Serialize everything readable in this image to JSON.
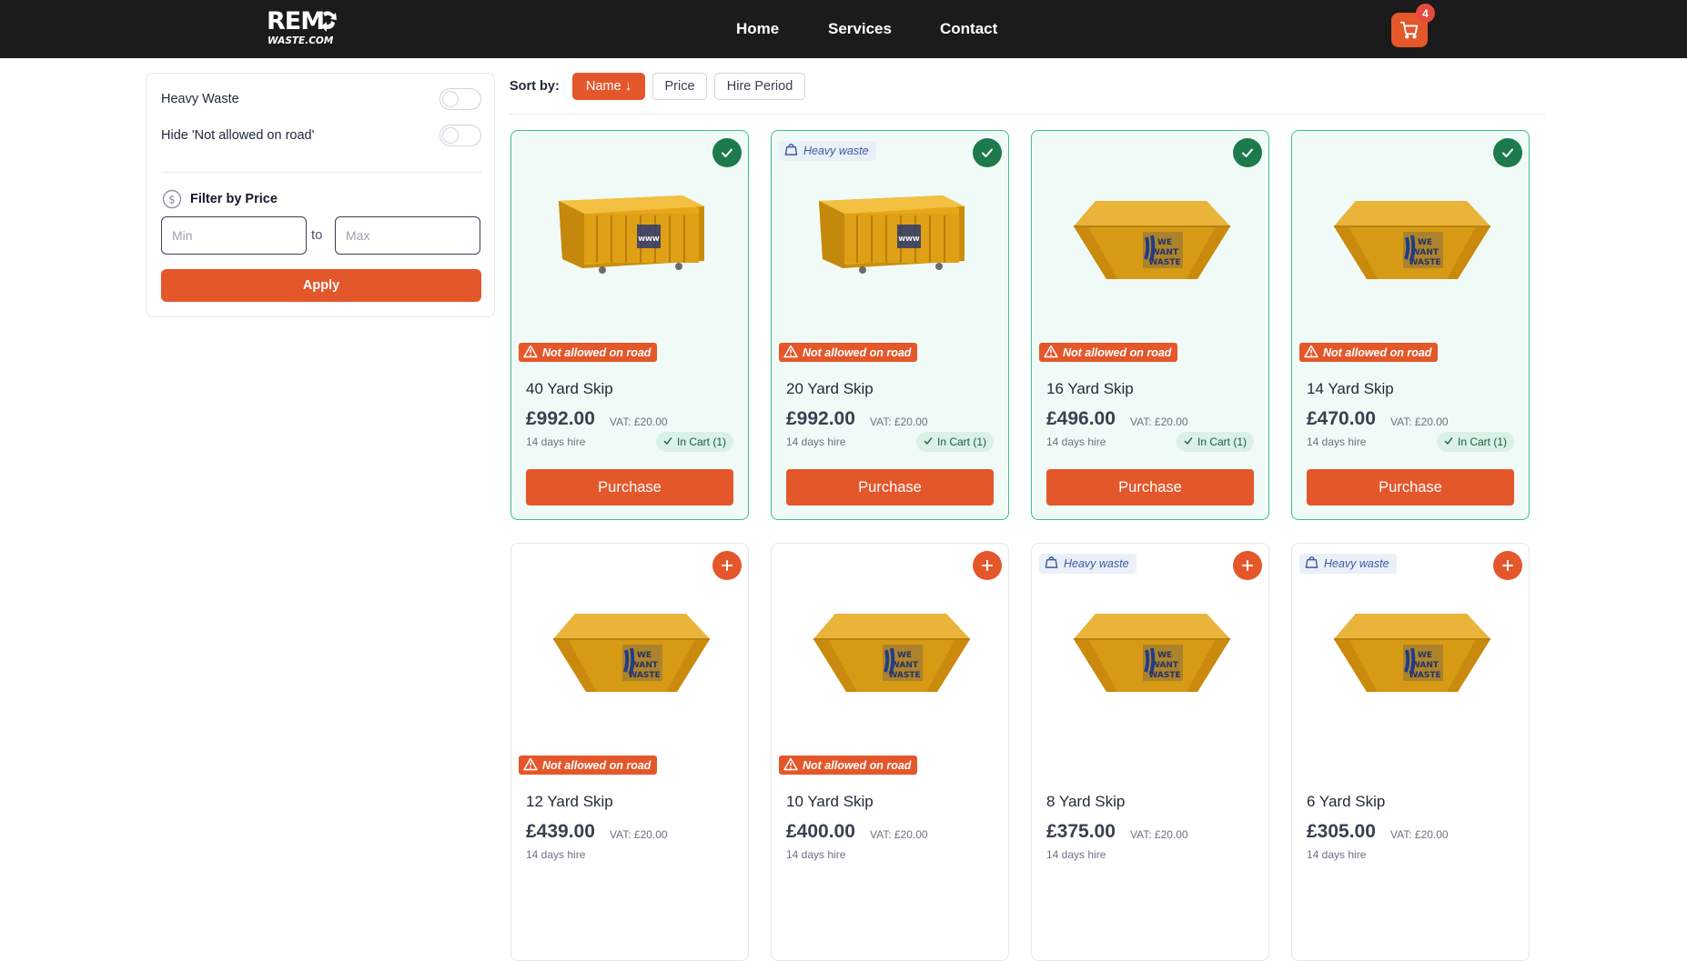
{
  "header": {
    "logo_line1": "REM",
    "logo_line2": "WASTE.COM",
    "nav": [
      "Home",
      "Services",
      "Contact"
    ],
    "cart_count": "4"
  },
  "sidebar": {
    "toggles": [
      {
        "label": "Heavy Waste",
        "on": false
      },
      {
        "label": "Hide 'Not allowed on road'",
        "on": false
      }
    ],
    "price_filter": {
      "title": "Filter by Price",
      "min_placeholder": "Min",
      "max_placeholder": "Max",
      "to_label": "to",
      "apply_label": "Apply"
    }
  },
  "sort": {
    "label": "Sort by:",
    "options": [
      "Name ↓",
      "Price",
      "Hire Period"
    ],
    "active": "Name ↓"
  },
  "labels": {
    "heavy": "Heavy waste",
    "road": "Not allowed on road",
    "vat": "VAT: £20.00",
    "hire": "14 days hire",
    "in_cart": "In Cart (1)",
    "purchase": "Purchase"
  },
  "colors": {
    "accent": "#e4572b",
    "success": "#1c7a4c",
    "selected_border": "#3ebd8e",
    "topbar": "#1b1b1b"
  },
  "skips": [
    {
      "name": "40 Yard Skip",
      "price": "£992.00",
      "vat": "VAT: £20.00",
      "hire": "14 days hire",
      "in_cart": true,
      "cart_label": "In Cart (1)",
      "heavy": false,
      "not_on_road": true,
      "shape": "roro"
    },
    {
      "name": "20 Yard Skip",
      "price": "£992.00",
      "vat": "VAT: £20.00",
      "hire": "14 days hire",
      "in_cart": true,
      "cart_label": "In Cart (1)",
      "heavy": true,
      "not_on_road": true,
      "shape": "roro"
    },
    {
      "name": "16 Yard Skip",
      "price": "£496.00",
      "vat": "VAT: £20.00",
      "hire": "14 days hire",
      "in_cart": true,
      "cart_label": "In Cart (1)",
      "heavy": false,
      "not_on_road": true,
      "shape": "skip"
    },
    {
      "name": "14 Yard Skip",
      "price": "£470.00",
      "vat": "VAT: £20.00",
      "hire": "14 days hire",
      "in_cart": true,
      "cart_label": "In Cart (1)",
      "heavy": false,
      "not_on_road": true,
      "shape": "skip"
    },
    {
      "name": "12 Yard Skip",
      "price": "£439.00",
      "vat": "VAT: £20.00",
      "hire": "14 days hire",
      "in_cart": false,
      "heavy": false,
      "not_on_road": true,
      "shape": "skip"
    },
    {
      "name": "10 Yard Skip",
      "price": "£400.00",
      "vat": "VAT: £20.00",
      "hire": "14 days hire",
      "in_cart": false,
      "heavy": false,
      "not_on_road": true,
      "shape": "skip"
    },
    {
      "name": "8 Yard Skip",
      "price": "£375.00",
      "vat": "VAT: £20.00",
      "hire": "14 days hire",
      "in_cart": false,
      "heavy": true,
      "not_on_road": false,
      "shape": "skip"
    },
    {
      "name": "6 Yard Skip",
      "price": "£305.00",
      "vat": "VAT: £20.00",
      "hire": "14 days hire",
      "in_cart": false,
      "heavy": true,
      "not_on_road": false,
      "shape": "skip"
    }
  ]
}
